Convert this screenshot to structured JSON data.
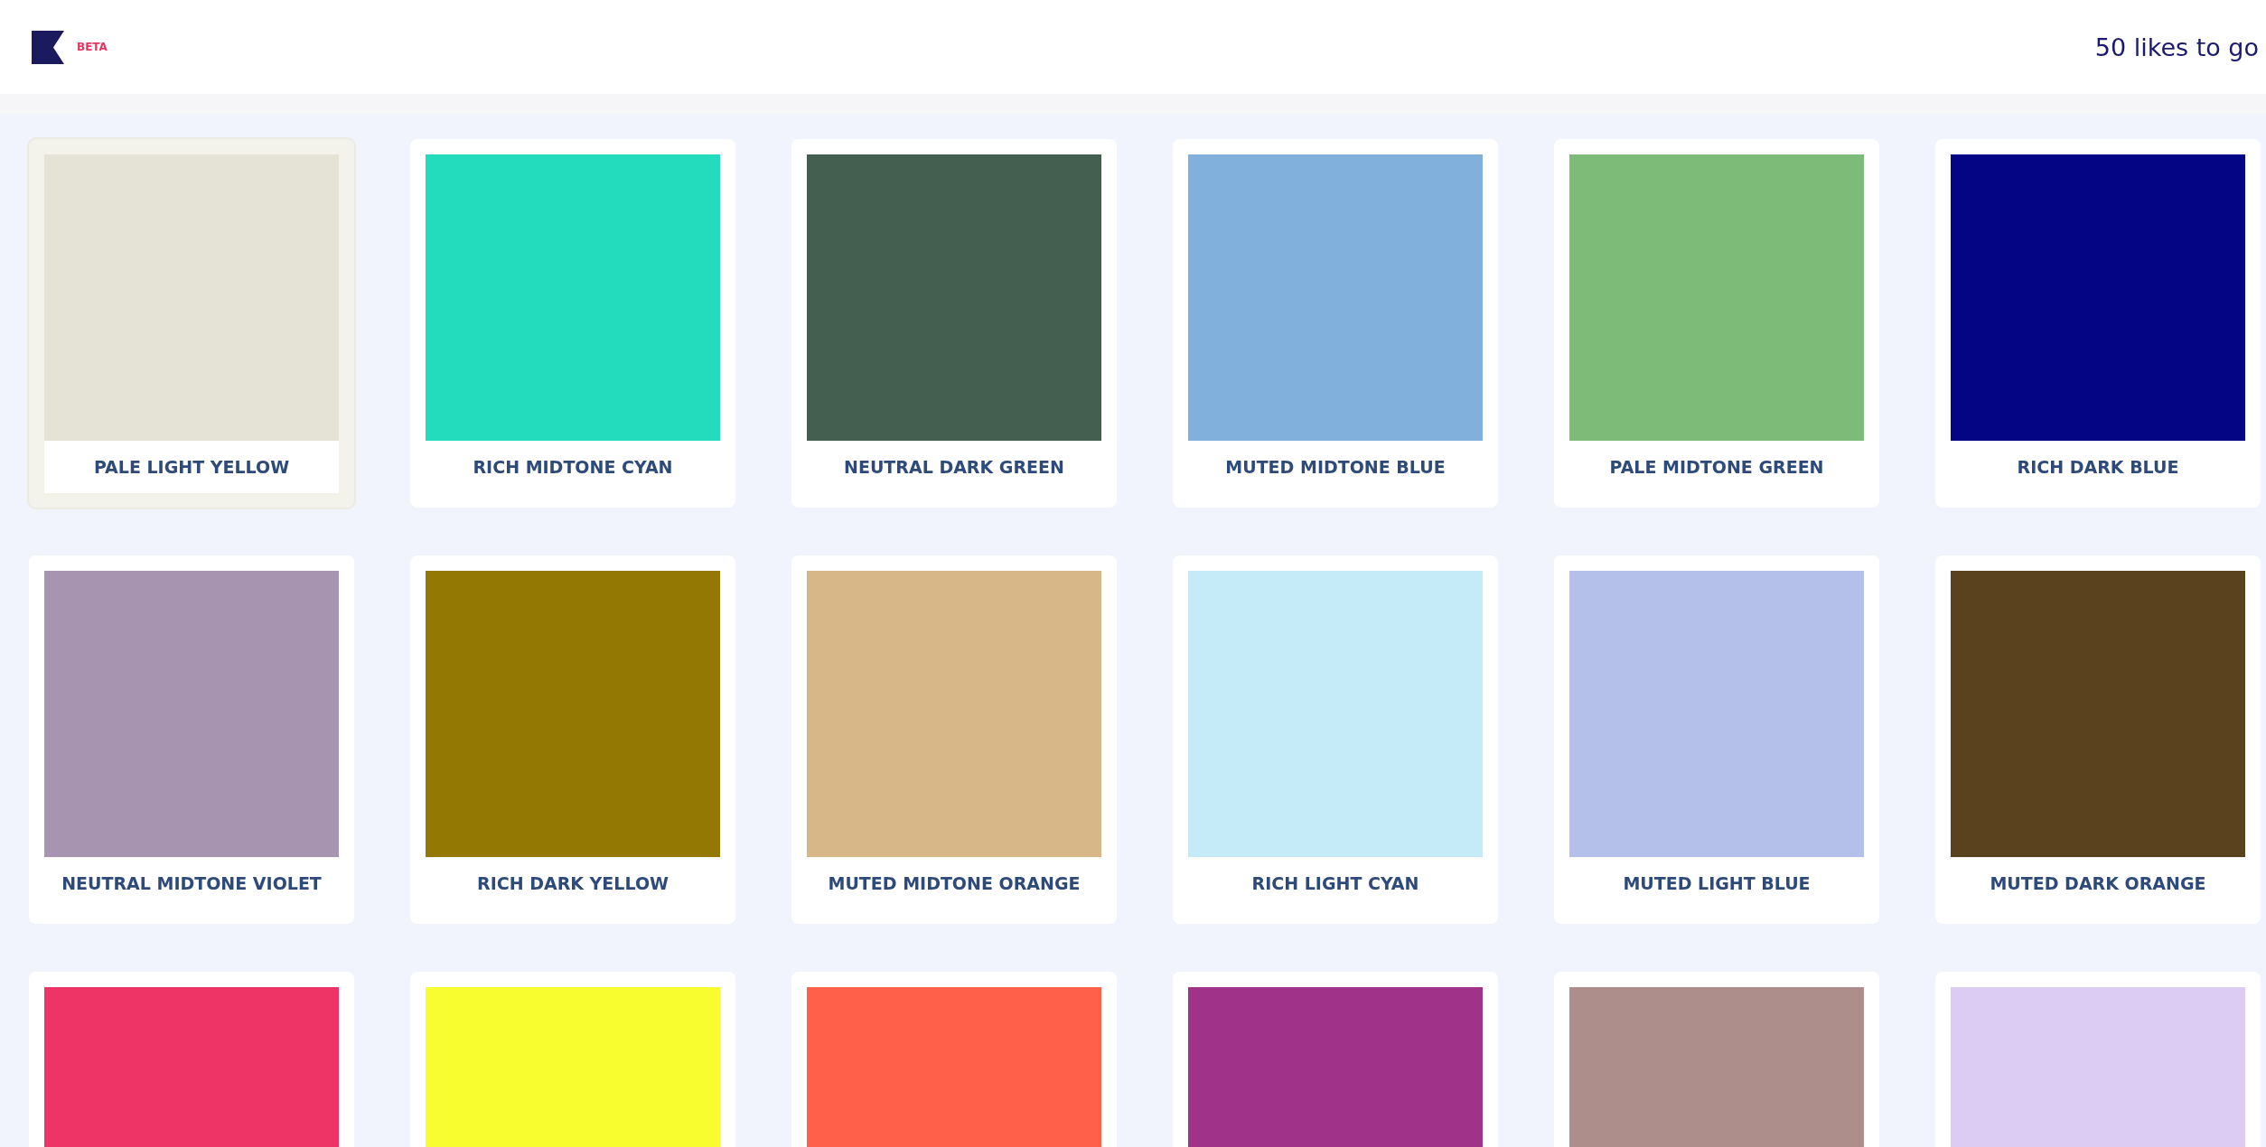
{
  "header": {
    "badge": "BETA",
    "likes": "50 likes to go"
  },
  "swatches": [
    {
      "label": "PALE LIGHT YELLOW",
      "color": "#e5e3d5",
      "selected": true
    },
    {
      "label": "RICH MIDTONE CYAN",
      "color": "#23dbbd",
      "selected": false
    },
    {
      "label": "NEUTRAL DARK GREEN",
      "color": "#445f4f",
      "selected": false
    },
    {
      "label": "MUTED MIDTONE BLUE",
      "color": "#82b0dc",
      "selected": false
    },
    {
      "label": "PALE MIDTONE GREEN",
      "color": "#7dbb78",
      "selected": false
    },
    {
      "label": "RICH DARK BLUE",
      "color": "#040584",
      "selected": false
    },
    {
      "label": "NEUTRAL MIDTONE VIOLET",
      "color": "#a794b0",
      "selected": false
    },
    {
      "label": "RICH DARK YELLOW",
      "color": "#937804",
      "selected": false
    },
    {
      "label": "MUTED MIDTONE ORANGE",
      "color": "#d7b688",
      "selected": false
    },
    {
      "label": "RICH LIGHT CYAN",
      "color": "#c5ebf9",
      "selected": false
    },
    {
      "label": "MUTED LIGHT BLUE",
      "color": "#b4bfea",
      "selected": false
    },
    {
      "label": "MUTED DARK ORANGE",
      "color": "#5a421f",
      "selected": false
    },
    {
      "color": "#ee3466",
      "selected": false
    },
    {
      "color": "#f7fd2e",
      "selected": false
    },
    {
      "color": "#ff604a",
      "selected": false
    },
    {
      "color": "#a0328a",
      "selected": false
    },
    {
      "color": "#ae8e8b",
      "selected": false
    },
    {
      "color": "#dccbf2",
      "selected": false
    }
  ]
}
